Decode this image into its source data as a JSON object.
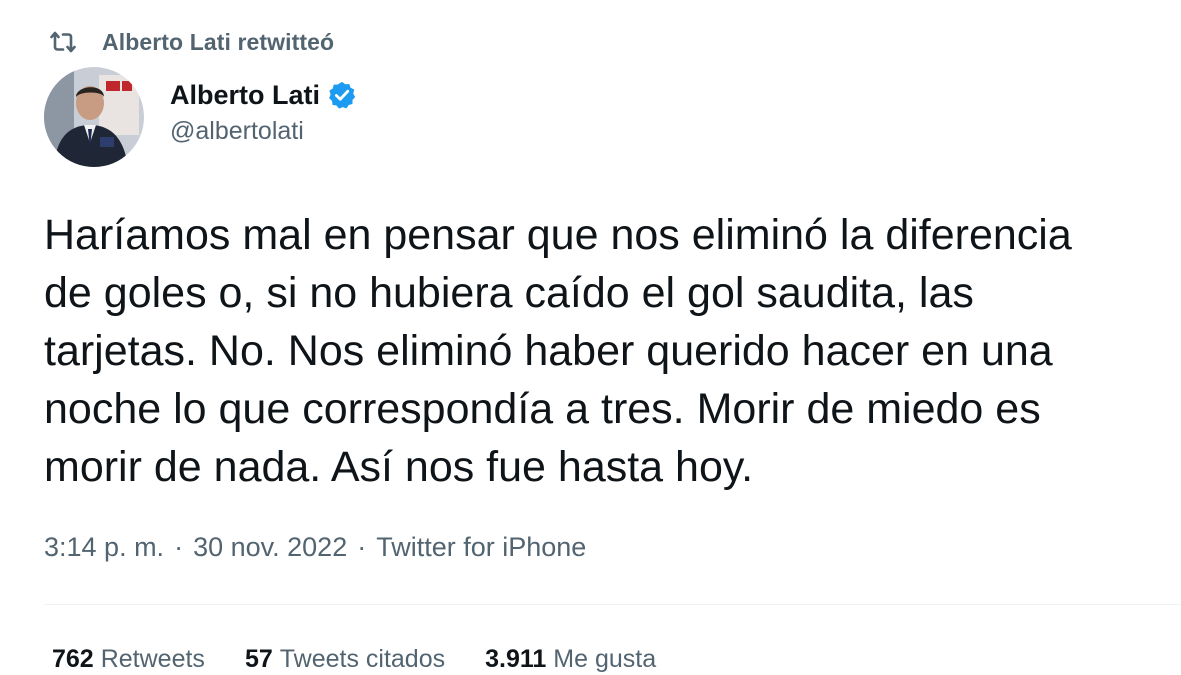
{
  "retweet_header": {
    "icon": "retweet-icon",
    "text": "Alberto Lati retwitteó"
  },
  "author": {
    "avatar_icon": "avatar",
    "display_name": "Alberto Lati",
    "verified_icon": "verified-badge-icon",
    "handle": "@albertolati"
  },
  "tweet": {
    "text": "Haríamos mal en pensar que nos eliminó la diferencia\nde goles o, si no hubiera caído el gol saudita, las\ntarjetas. No. Nos eliminó haber querido hacer en una\nnoche lo que correspondía a tres. Morir de miedo es\nmorir de nada. Así nos fue hasta hoy."
  },
  "meta": {
    "time": "3:14 p. m.",
    "separator": "·",
    "date": "30 nov. 2022",
    "source": "Twitter for iPhone"
  },
  "stats": [
    {
      "count": "762",
      "label": "Retweets"
    },
    {
      "count": "57",
      "label": "Tweets citados"
    },
    {
      "count": "3.911",
      "label": "Me gusta"
    }
  ],
  "colors": {
    "text": "#0f1419",
    "secondary": "#536471",
    "verified": "#1d9bf0",
    "divider": "#eff3f4"
  }
}
